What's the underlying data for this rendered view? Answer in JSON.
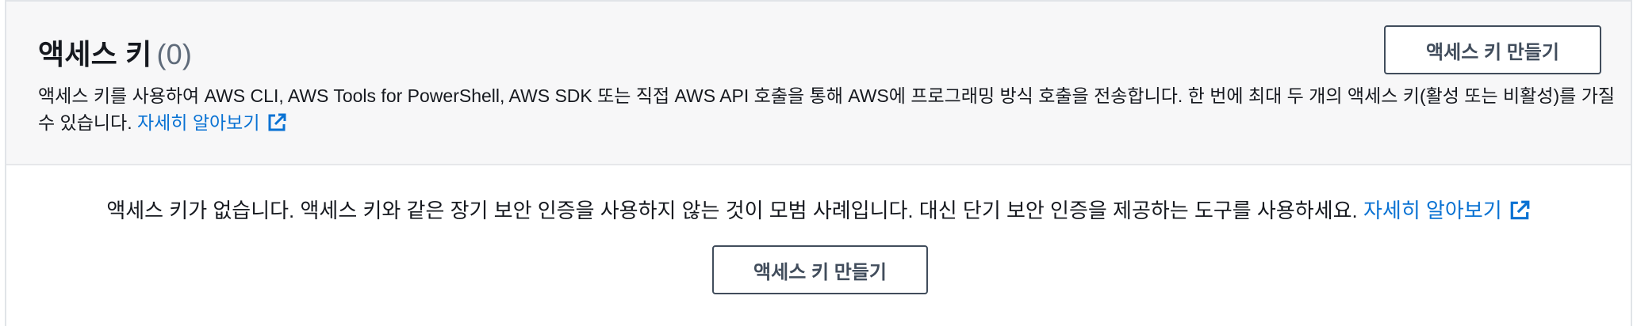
{
  "header": {
    "title": "액세스 키",
    "count": "(0)",
    "description": "액세스 키를 사용하여 AWS CLI, AWS Tools for PowerShell, AWS SDK 또는 직접 AWS API 호출을 통해 AWS에 프로그래밍 방식 호출을 전송합니다. 한 번에 최대 두 개의 액세스 키(활성 또는 비활성)를 가질 수 있습니다.",
    "learn_more": "자세히 알아보기",
    "create_button": "액세스 키 만들기"
  },
  "empty_state": {
    "message": "액세스 키가 없습니다. 액세스 키와 같은 장기 보안 인증을 사용하지 않는 것이 모범 사례입니다. 대신 단기 보안 인증을 제공하는 도구를 사용하세요.",
    "learn_more": "자세히 알아보기",
    "create_button": "액세스 키 만들기"
  },
  "icons": {
    "external_link": "external-link-icon"
  },
  "colors": {
    "link": "#0972d3",
    "button_border": "#414d5c",
    "header_bg": "#f7f7f8"
  }
}
